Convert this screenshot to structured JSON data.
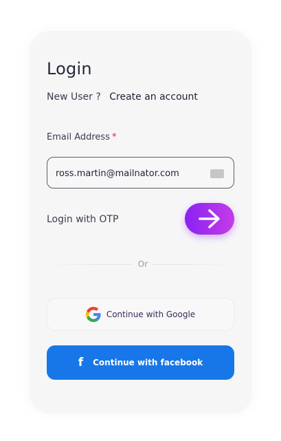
{
  "login": {
    "title": "Login",
    "new_user_prompt": "New User ?",
    "create_account_link": "Create an account",
    "email_label": "Email Address",
    "required_marker": "*",
    "email_value": "ross.martin@mailnator.com",
    "otp_label": "Login with OTP",
    "divider_text": "Or",
    "google_button_label": "Continue with Google",
    "facebook_button_label": "Continue with facebook",
    "facebook_glyph": "f"
  },
  "colors": {
    "accent_gradient_start": "#8a22f2",
    "accent_gradient_end": "#c43ce8",
    "facebook_blue": "#1877e8",
    "card_background": "#f6f6f7",
    "required_red": "#d6244c"
  },
  "icons": {
    "arrow": "arrow-right-icon",
    "google": "google-logo-icon",
    "facebook": "facebook-f-icon",
    "autofill": "autofill-card-icon"
  }
}
